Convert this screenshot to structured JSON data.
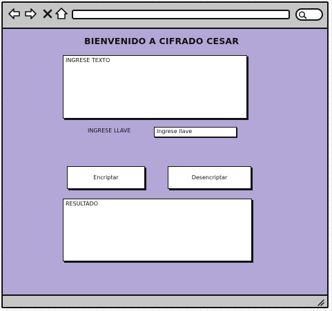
{
  "main": {
    "title": "BIENVENIDO A CIFRADO CESAR",
    "input_text_label": "INGRESE TEXTO",
    "key_label": "INGRESE LLAVE",
    "key_input_value": "Ingrese llave",
    "encrypt_button_label": "Encriptar",
    "decrypt_button_label": "Desencriptar",
    "result_label": "RESULTADO"
  },
  "toolbar": {
    "icons": [
      "back-icon",
      "forward-icon",
      "close-icon",
      "home-icon"
    ],
    "search_icon": "search-icon"
  },
  "colors": {
    "page_background": "#b3a7d8",
    "chrome": "#c6c6c6"
  }
}
